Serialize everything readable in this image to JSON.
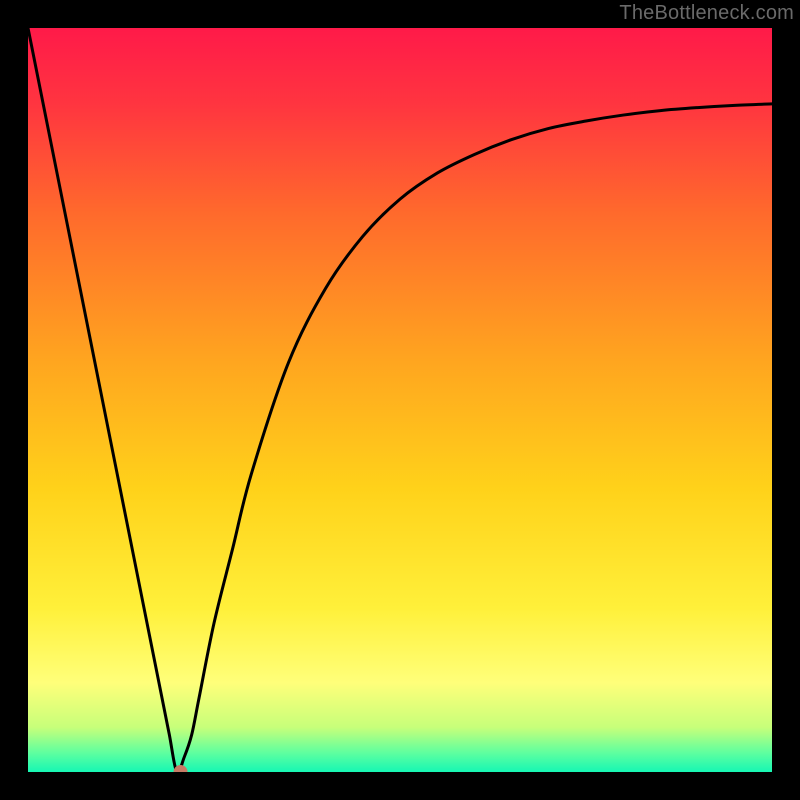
{
  "attribution": "TheBottleneck.com",
  "chart_data": {
    "type": "line",
    "title": "",
    "xlabel": "",
    "ylabel": "",
    "xlim": [
      0,
      100
    ],
    "ylim": [
      0,
      100
    ],
    "grid": false,
    "legend": false,
    "background_gradient": {
      "stops": [
        {
          "pos": 0.0,
          "color": "#ff1a49"
        },
        {
          "pos": 0.1,
          "color": "#ff3440"
        },
        {
          "pos": 0.25,
          "color": "#ff6a2c"
        },
        {
          "pos": 0.45,
          "color": "#ffa61f"
        },
        {
          "pos": 0.62,
          "color": "#ffd21a"
        },
        {
          "pos": 0.78,
          "color": "#fff03a"
        },
        {
          "pos": 0.88,
          "color": "#ffff7a"
        },
        {
          "pos": 0.94,
          "color": "#c7ff7a"
        },
        {
          "pos": 0.975,
          "color": "#5cffa0"
        },
        {
          "pos": 1.0,
          "color": "#16f7b4"
        }
      ]
    },
    "series": [
      {
        "name": "curve",
        "color": "#000000",
        "x": [
          0,
          5,
          10,
          15,
          18,
          19,
          20,
          21,
          22,
          23,
          25,
          27.5,
          30,
          35,
          40,
          45,
          50,
          55,
          60,
          65,
          70,
          75,
          80,
          85,
          90,
          95,
          100
        ],
        "y": [
          100,
          75,
          50,
          25,
          10,
          5,
          0,
          2,
          5,
          10,
          20,
          30,
          40,
          55,
          65,
          72,
          77,
          80.5,
          83,
          85,
          86.5,
          87.5,
          88.3,
          88.9,
          89.3,
          89.6,
          89.8
        ]
      }
    ],
    "markers": [
      {
        "name": "marker-dot",
        "x": 20.5,
        "y": 0,
        "color": "#c77b66",
        "radius_px": 7
      }
    ]
  }
}
